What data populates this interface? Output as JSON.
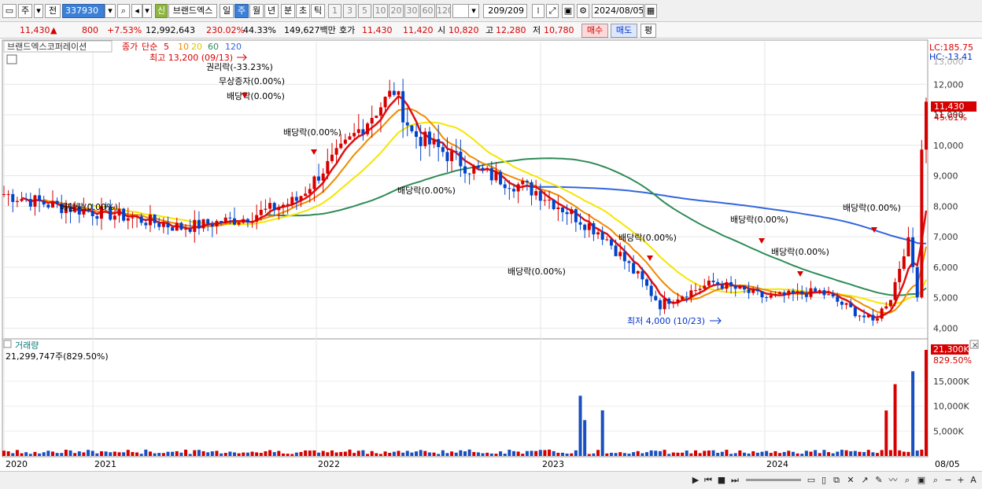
{
  "toolbar": {
    "period_type": "주",
    "prev_label": "전",
    "code": "337930",
    "new_badge": "신",
    "stock_name": "브랜드엑스",
    "periods": [
      "일",
      "주",
      "월",
      "년",
      "분",
      "초",
      "틱"
    ],
    "active_period": "주",
    "intervals": [
      "1",
      "3",
      "5",
      "10",
      "20",
      "30",
      "60",
      "120"
    ],
    "count": "209",
    "count_total": "/209",
    "date": "2024/08/05"
  },
  "quote": {
    "price": "11,430",
    "change": "800",
    "change_pct": "+7.53%",
    "volume": "12,992,643",
    "volume_ratio": "230.02%",
    "turnover": "44.33%",
    "amount": "149,627백만",
    "ask_label": "호가",
    "ask": "11,430",
    "bid": "11,420",
    "open_label": "시",
    "open": "10,820",
    "high_label": "고",
    "high": "12,280",
    "low_label": "저",
    "low": "10,780",
    "buy_label": "매수",
    "sell_label": "매도",
    "avg_label": "평"
  },
  "legend": {
    "company": "브랜드엑스코퍼레이션",
    "price_label": "종가",
    "ma_type": "단순",
    "ma_periods": [
      "5",
      "10",
      "20",
      "60",
      "120"
    ],
    "lc_label": "LC:185.75",
    "hc_label": "HC:-13.41",
    "volume_title": "거래량",
    "volume_value": "21,299,747주(829.50%)"
  },
  "price_axis": {
    "ticks": [
      "12,000",
      "11,000",
      "10,000",
      "9,000",
      "8,000",
      "7,000",
      "6,000",
      "5,000",
      "4,000"
    ],
    "partial_tick": "13,000",
    "current_price": "11,430",
    "current_pct": "45.61%"
  },
  "volume_axis": {
    "ticks": [
      "15,000K",
      "10,000K",
      "5,000K"
    ],
    "current_volume": "21,300K",
    "current_pct": "829.50%"
  },
  "x_axis": {
    "years": [
      "2020",
      "2021",
      "2022",
      "2023",
      "2024"
    ],
    "last_date": "08/05"
  },
  "annotations": [
    "최고 13,200 (09/13)",
    "권리락(-33.23%)",
    "무상증자(0.00%)",
    "배당락(0.00%)",
    "배당락(0.00%)",
    "배당락(0.00%)",
    "배당락(0.00%)",
    "배당락(0.00%)",
    "배당락(0.00%)",
    "배당락(0.00%)",
    "배당락(0.00%)",
    "배당락(0.00%)",
    "최저 4,000 (10/23)"
  ],
  "colors": {
    "up": "#d60000",
    "down": "#0044cc",
    "ma5": "#e01010",
    "ma10": "#f08a00",
    "ma20": "#f5e600",
    "ma60": "#2e8b57",
    "ma120": "#3366dd",
    "volume_up": "#d60000",
    "volume_down": "#1a4fbf"
  },
  "chart_data": {
    "type": "candlestick",
    "x": [
      "2020-01",
      "2020-04",
      "2020-07",
      "2020-10",
      "2021-01",
      "2021-04",
      "2021-07",
      "2021-09",
      "2021-10",
      "2022-01",
      "2022-04",
      "2022-07",
      "2022-10",
      "2023-01",
      "2023-04",
      "2023-07",
      "2023-10",
      "2024-01",
      "2024-02",
      "2024-04",
      "2024-06",
      "2024-07",
      "2024-08"
    ],
    "close": [
      8400,
      8000,
      7700,
      7300,
      7600,
      8200,
      10500,
      11800,
      10400,
      9200,
      8500,
      7100,
      4800,
      5500,
      5000,
      5200,
      4200,
      6500,
      5200,
      5000,
      6800,
      8400,
      11430
    ],
    "ma_lines": [
      "MA5",
      "MA10",
      "MA20",
      "MA60",
      "MA120"
    ],
    "volume_unit": "K",
    "volume_final": 21300,
    "y_range": [
      3700,
      13400
    ],
    "volume_range": [
      0,
      21300
    ]
  }
}
